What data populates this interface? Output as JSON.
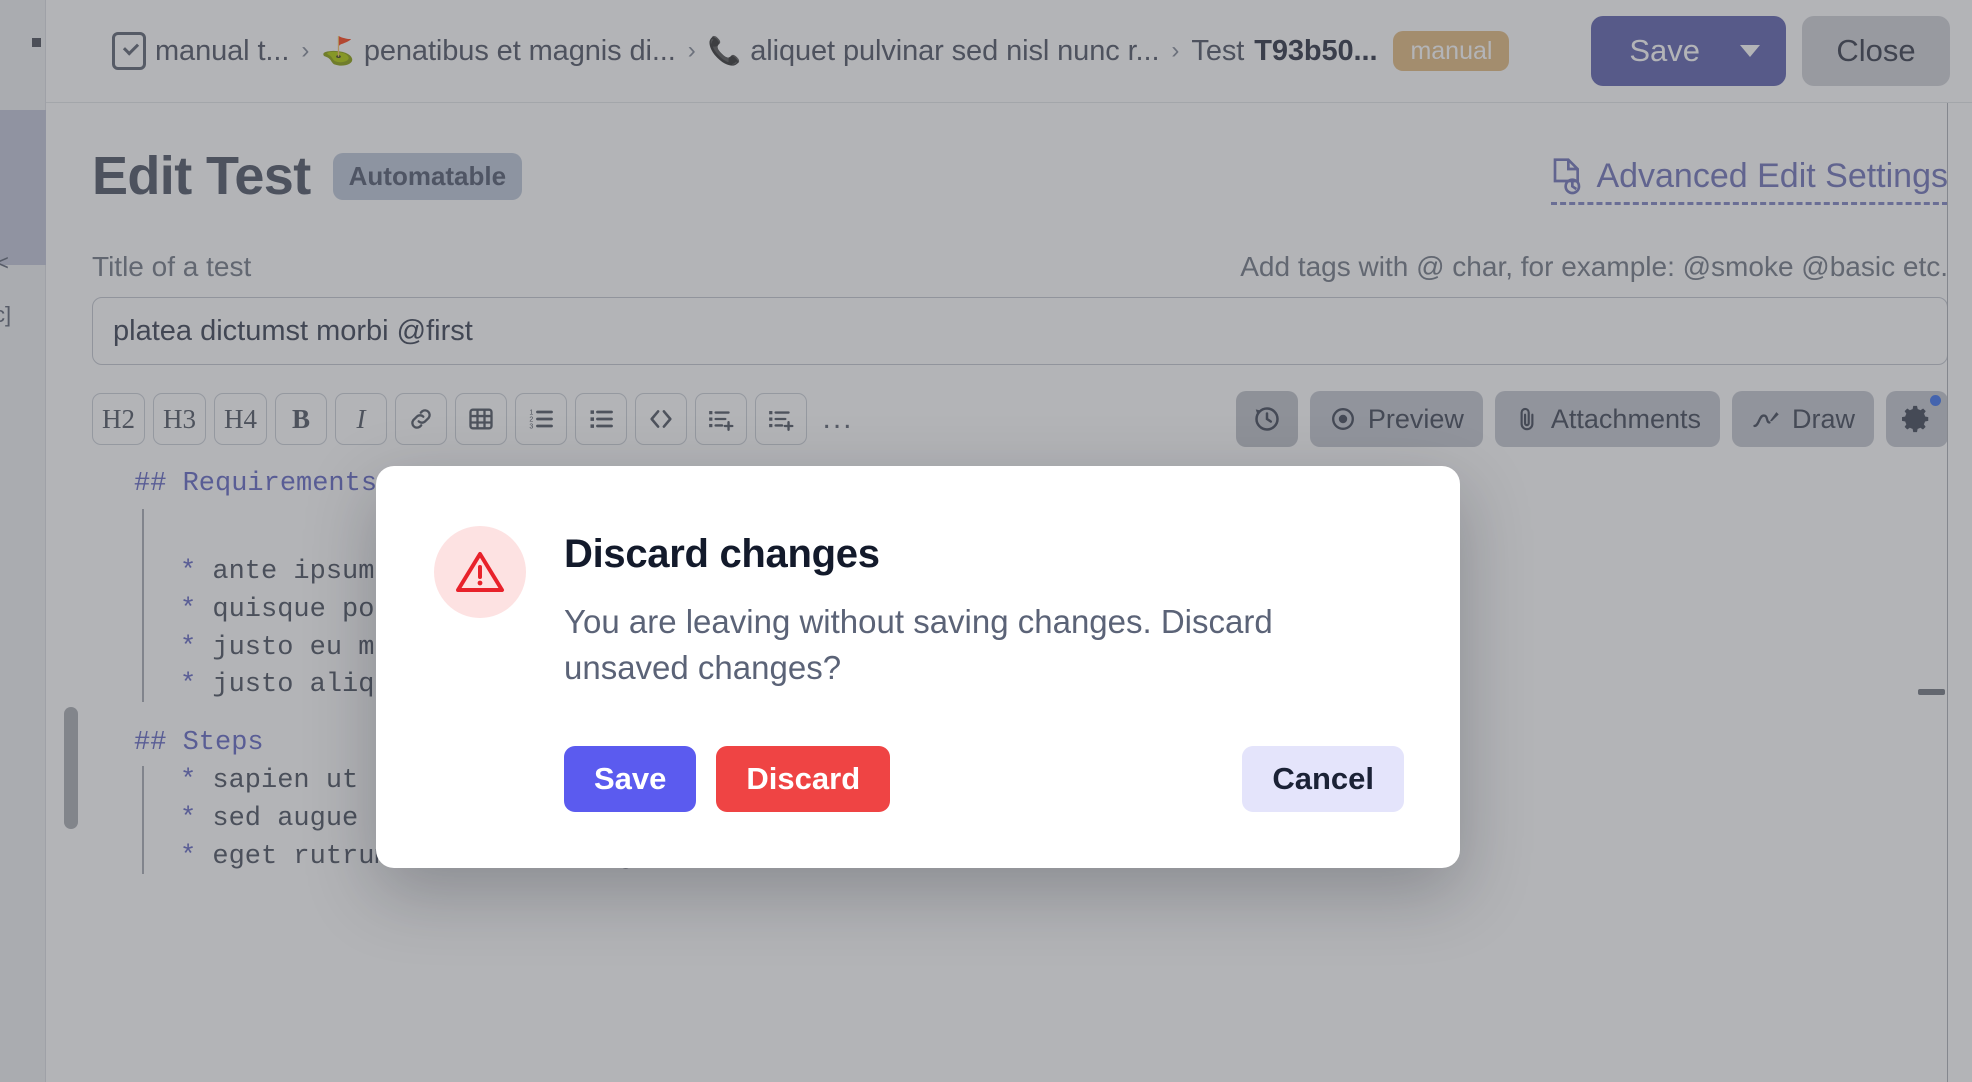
{
  "header": {
    "breadcrumb": [
      {
        "icon": "document-check-icon",
        "label": "manual t...",
        "glyph": ""
      },
      {
        "icon": "golf-flag-icon",
        "label": "penatibus et magnis di...",
        "glyph": "⛳"
      },
      {
        "icon": "phone-icon",
        "label": "aliquet pulvinar sed nisl nunc r...",
        "glyph": "📞"
      }
    ],
    "separator": "›",
    "test_crumb_prefix": "Test",
    "test_crumb_id": "T93b50...",
    "test_type_chip": "manual",
    "save_label": "Save",
    "close_label": "Close"
  },
  "page": {
    "title": "Edit Test",
    "badge": "Automatable",
    "advanced_link": "Advanced Edit Settings"
  },
  "form": {
    "title_label": "Title of a test",
    "tags_hint": "Add tags with @ char, for example: @smoke @basic etc.",
    "title_value": "platea dictumst morbi @first",
    "title_placeholder": "Title of a test"
  },
  "toolbar": {
    "format_buttons": [
      {
        "name": "heading-2-button",
        "label": "H2"
      },
      {
        "name": "heading-3-button",
        "label": "H3"
      },
      {
        "name": "heading-4-button",
        "label": "H4"
      },
      {
        "name": "bold-button",
        "label": "B"
      },
      {
        "name": "italic-button",
        "label": "I"
      },
      {
        "name": "link-button",
        "label": "🔗"
      },
      {
        "name": "table-button",
        "label": "▦"
      },
      {
        "name": "ordered-list-button",
        "label": "≔"
      },
      {
        "name": "bullet-list-button",
        "label": "☰"
      },
      {
        "name": "code-block-button",
        "label": "<>"
      },
      {
        "name": "add-checklist-button",
        "label": "⊞"
      },
      {
        "name": "add-numbered-step-button",
        "label": "⊟"
      }
    ],
    "overflow_label": "...",
    "history_label": "",
    "preview_label": "Preview",
    "attachments_label": "Attachments",
    "draw_label": "Draw",
    "settings_label": ""
  },
  "editor": {
    "requirements_heading": "## Requirements",
    "requirements_items": [
      "ante ipsum primis in faucibus orci luctus et ultrices posuere cubilia",
      "quisque porta volutpat erat quisque erat eros viverra eget",
      "justo eu massa donec dapibus duis at velit eu est congue",
      "justo aliquam quis turpis eget elit sodales scelerisque mauris"
    ],
    "steps_heading": "## Steps",
    "steps_items": [
      "sapien ut nunc vestibulum ante",
      "sed augue aliquam erat volutpat in",
      "eget rutrum at lorem integer"
    ],
    "bullet_marker": "*"
  },
  "modal": {
    "title": "Discard changes",
    "description": "You are leaving without saving changes. Discard unsaved changes?",
    "save_label": "Save",
    "discard_label": "Discard",
    "cancel_label": "Cancel",
    "icon": "warning-triangle-icon"
  },
  "sidebar": {
    "fragment_text_1": "<",
    "fragment_text_2": "c]"
  },
  "colors": {
    "accent_save": "#5b5bef",
    "danger": "#ef4444",
    "cancel_bg": "#e4e4fb",
    "header_save": "#6b6fb5",
    "chip_manual": "#e6c08a",
    "badge_auto": "#c2cbdb",
    "markdown_accent": "#6f73c9"
  }
}
